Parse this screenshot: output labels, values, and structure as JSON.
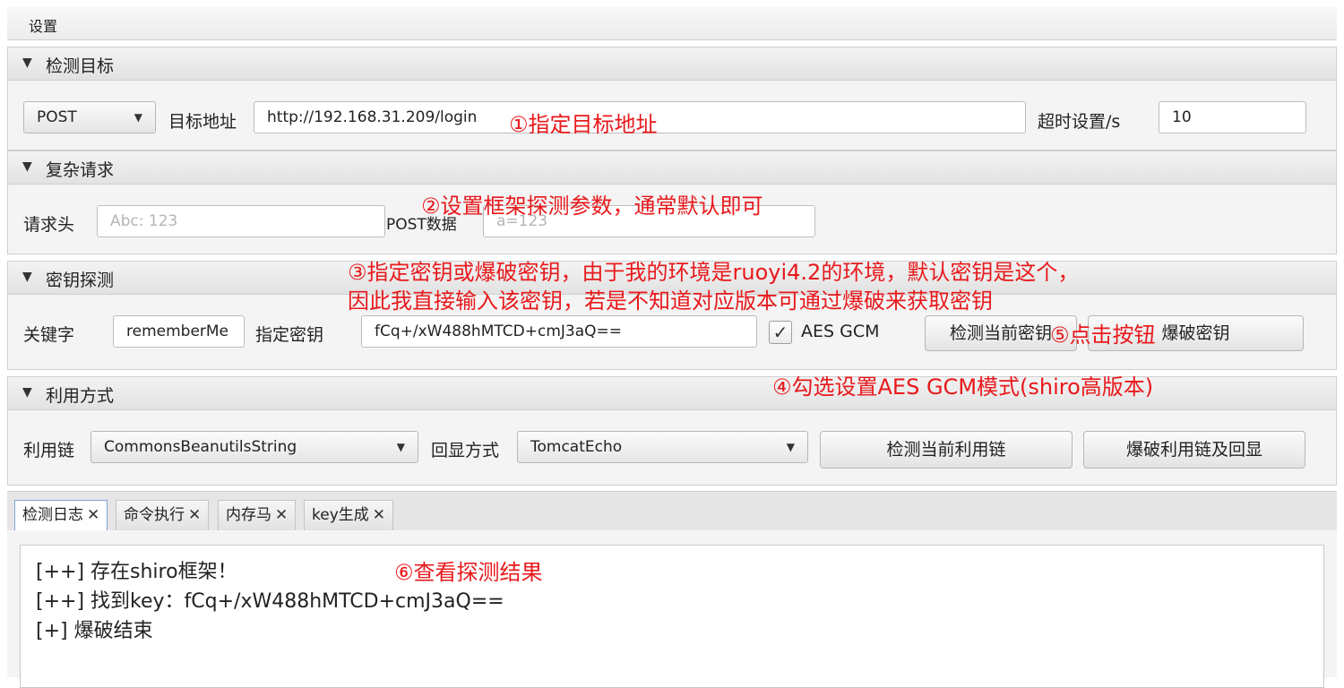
{
  "menu": {
    "settings": "设置"
  },
  "target_panel": {
    "title": "检测目标",
    "method": "POST",
    "url_label": "目标地址",
    "url_value": "http://192.168.31.209/login",
    "timeout_label": "超时设置/s",
    "timeout_value": "10"
  },
  "request_panel": {
    "title": "复杂请求",
    "header_label": "请求头",
    "header_placeholder": "Abc: 123",
    "post_label": "POST数据",
    "post_placeholder": "a=123"
  },
  "key_panel": {
    "title": "密钥探测",
    "keyword_label": "关键字",
    "keyword_value": "rememberMe",
    "key_label": "指定密钥",
    "key_value": "fCq+/xW488hMTCD+cmJ3aQ==",
    "aes_gcm_label": "AES GCM",
    "aes_gcm_checked": true,
    "check_key_button": "检测当前密钥",
    "brute_key_button": "爆破密钥"
  },
  "exploit_panel": {
    "title": "利用方式",
    "chain_label": "利用链",
    "chain_value": "CommonsBeanutilsString",
    "echo_label": "回显方式",
    "echo_value": "TomcatEcho",
    "check_chain_button": "检测当前利用链",
    "brute_chain_button": "爆破利用链及回显"
  },
  "tabs": [
    {
      "label": "检测日志",
      "active": true
    },
    {
      "label": "命令执行",
      "active": false
    },
    {
      "label": "内存马",
      "active": false
    },
    {
      "label": "key生成",
      "active": false
    }
  ],
  "tab_close_glyph": "✕",
  "log_lines": [
    "[++] 存在shiro框架！",
    "[++] 找到key：fCq+/xW488hMTCD+cmJ3aQ==",
    "[+] 爆破结束"
  ],
  "annotations": {
    "a1": "①指定目标地址",
    "a2": "②设置框架探测参数，通常默认即可",
    "a3_line1": "③指定密钥或爆破密钥，由于我的环境是ruoyi4.2的环境，默认密钥是这个，",
    "a3_line2": "因此我直接输入该密钥，若是不知道对应版本可通过爆破来获取密钥",
    "a4": "④勾选设置AES GCM模式(shiro高版本)",
    "a5": "⑤点击按钮",
    "a6": "⑥查看探测结果"
  },
  "colors": {
    "annotation": "#e8191c",
    "active_tab_border": "#7fa7d8"
  }
}
